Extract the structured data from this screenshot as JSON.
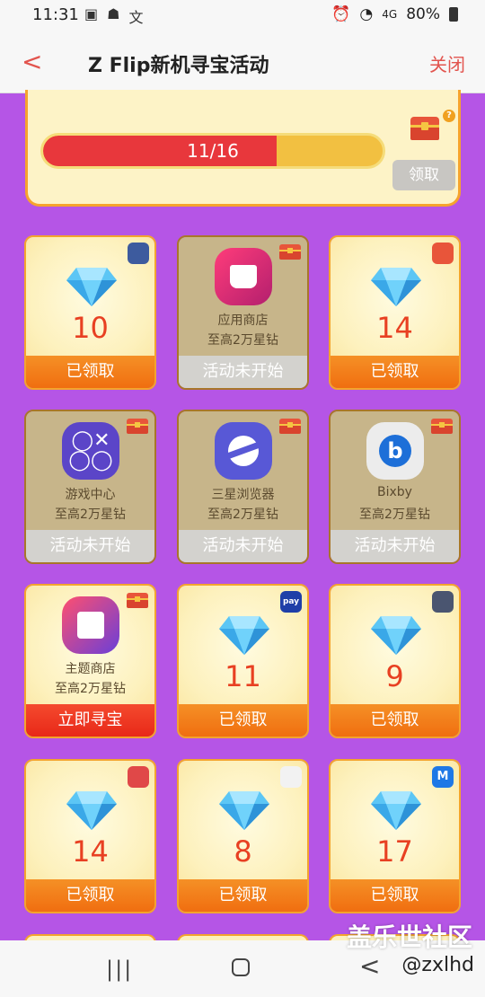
{
  "status": {
    "time": "11:31",
    "battery": "80%",
    "signal": "4G"
  },
  "header": {
    "title": "Z Flip新机寻宝活动",
    "close_label": "关闭"
  },
  "progress": {
    "text": "11/16",
    "value": 0.6875,
    "claim_label": "领取"
  },
  "cards": [
    {
      "type": "gem",
      "value": "10",
      "footer": "已领取",
      "footer_style": "orange",
      "badge": "registered-icon",
      "badge_color": "#3d5b9e"
    },
    {
      "type": "app",
      "app_name": "应用商店",
      "subtitle": "至高2万星钻",
      "footer": "活动未开始",
      "footer_style": "gray",
      "icon": "galaxy-store-icon",
      "badge": "chest-icon"
    },
    {
      "type": "gem",
      "value": "14",
      "footer": "已领取",
      "footer_style": "orange",
      "badge": "check-icon",
      "badge_color": "#e8553a"
    },
    {
      "type": "app",
      "app_name": "游戏中心",
      "subtitle": "至高2万星钻",
      "footer": "活动未开始",
      "footer_style": "gray",
      "icon": "game-center-icon",
      "badge": "chest-icon"
    },
    {
      "type": "app",
      "app_name": "三星浏览器",
      "subtitle": "至高2万星钻",
      "footer": "活动未开始",
      "footer_style": "gray",
      "icon": "browser-icon",
      "badge": "chest-icon"
    },
    {
      "type": "app",
      "app_name": "Bixby",
      "subtitle": "至高2万星钻",
      "footer": "活动未开始",
      "footer_style": "gray",
      "icon": "bixby-icon",
      "badge": "chest-icon"
    },
    {
      "type": "app",
      "app_name": "主题商店",
      "subtitle": "至高2万星钻",
      "footer": "立即寻宝",
      "footer_style": "red",
      "icon": "themes-icon",
      "badge": "chest-icon"
    },
    {
      "type": "gem",
      "value": "11",
      "footer": "已领取",
      "footer_style": "orange",
      "badge": "pay-icon",
      "badge_color": "#1f3fa8",
      "badge_text": "pay"
    },
    {
      "type": "gem",
      "value": "9",
      "footer": "已领取",
      "footer_style": "orange",
      "badge": "lock-icon",
      "badge_color": "#4a5570"
    },
    {
      "type": "gem",
      "value": "14",
      "footer": "已领取",
      "footer_style": "orange",
      "badge": "wallet-icon",
      "badge_color": "#e04848"
    },
    {
      "type": "gem",
      "value": "8",
      "footer": "已领取",
      "footer_style": "orange",
      "badge": "connect-icon",
      "badge_color": "#f2f2f2"
    },
    {
      "type": "gem",
      "value": "17",
      "footer": "已领取",
      "footer_style": "orange",
      "badge": "members-icon",
      "badge_color": "#1e78e6",
      "badge_text": "M"
    }
  ],
  "watermark": {
    "text": "盖乐世社区",
    "handle": "@zxlhd"
  },
  "nav": {
    "recents": "|||",
    "back": "<"
  }
}
